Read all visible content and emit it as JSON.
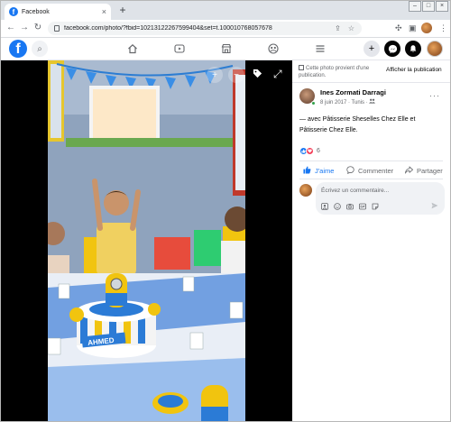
{
  "browser": {
    "tab_title": "Facebook",
    "tab_close": "×",
    "new_tab": "+",
    "url": "facebook.com/photo/?fbid=10213122267599404&set=t.100010768057678",
    "controls": {
      "minimize": "–",
      "maximize": "□",
      "close": "×"
    }
  },
  "fb": {
    "logo": "f",
    "search_icon": "⌕",
    "nav": [
      "home-icon",
      "watch-icon",
      "marketplace-icon",
      "groups-icon",
      "menu-icon"
    ],
    "create_label": "+"
  },
  "viewer": {
    "zoom_in": "+",
    "zoom_out": "−",
    "tag_icon": "tag-icon",
    "fullscreen_icon": "⤢",
    "cake_name": "AHMED"
  },
  "panel": {
    "notice_text": "Cette photo provient d'une publication.",
    "notice_link": "Afficher la publication",
    "author_name": "Ines Zormati Darragi",
    "author_meta": "8 juin 2017 · Tunis · ",
    "more": "···",
    "caption": "— avec Pâtisserie Sheselles Chez Elle et Pâtisserie Chez Elle.",
    "reaction_count": "6",
    "actions": {
      "like": "J'aime",
      "comment": "Commenter",
      "share": "Partager"
    },
    "comment_placeholder": "Écrivez un commentaire..."
  },
  "colors": {
    "brand": "#1877f2",
    "love": "#f33e58",
    "online": "#31a24c"
  }
}
